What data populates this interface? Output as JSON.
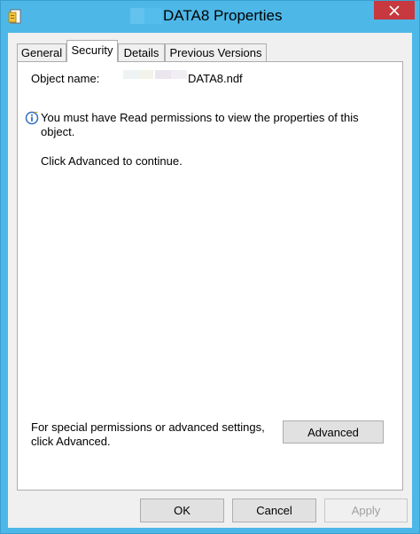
{
  "window": {
    "title": "DATA8 Properties",
    "close_label": "✕"
  },
  "tabs": [
    {
      "label": "General"
    },
    {
      "label": "Security"
    },
    {
      "label": "Details"
    },
    {
      "label": "Previous Versions"
    }
  ],
  "security": {
    "object_name_label": "Object name:",
    "object_name_value": "DATA8.ndf",
    "permission_message": "You must have Read permissions to view the properties of this object.",
    "advanced_hint": "Click Advanced to continue.",
    "special_permissions_text": "For special permissions or advanced settings, click Advanced.",
    "advanced_button": "Advanced"
  },
  "footer": {
    "ok_button": "OK",
    "cancel_button": "Cancel",
    "apply_button": "Apply"
  },
  "colors": {
    "titlebar": "#4db8e8",
    "close_button": "#c7383f",
    "client_background": "#f0f0f0"
  }
}
